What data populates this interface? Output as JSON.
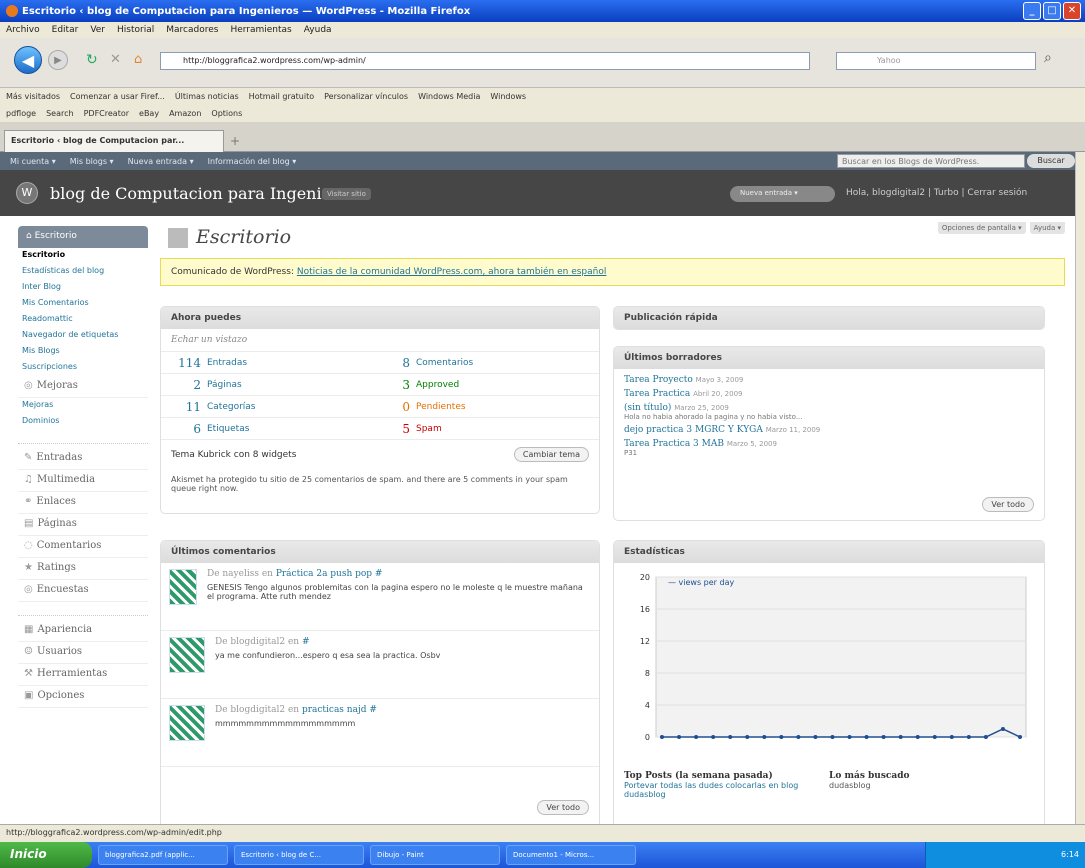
{
  "window": {
    "title": "Escritorio ‹ blog de Computacion para Ingenieros — WordPress - Mozilla Firefox"
  },
  "menu": [
    "Archivo",
    "Editar",
    "Ver",
    "Historial",
    "Marcadores",
    "Herramientas",
    "Ayuda"
  ],
  "nav": {
    "url": "http://bloggrafica2.wordpress.com/wp-admin/",
    "search_placeholder": "Yahoo"
  },
  "bookmarks": [
    "Más visitados",
    "Comenzar a usar Firef...",
    "Últimas noticias",
    "Hotmail gratuito",
    "Personalizar vínculos",
    "Windows Media",
    "Windows"
  ],
  "toolbar2": [
    "pdfloge",
    "Search",
    "PDFCreator",
    "eBay",
    "Amazon",
    "Options"
  ],
  "tab": {
    "label": "Escritorio ‹ blog de Computacion par..."
  },
  "adminbar": {
    "items": [
      "Mi cuenta ▾",
      "Mis blogs ▾",
      "Nueva entrada ▾",
      "Información del blog ▾"
    ],
    "search_placeholder": "Buscar en los Blogs de WordPress.",
    "search_button": "Buscar"
  },
  "wphead": {
    "site_title": "blog de Computacion para Ingenieros",
    "visit": "Visitar sitio",
    "new_post": "Nueva entrada ▾",
    "howdy": "Hola, blogdigital2 | Turbo | Cerrar sesión"
  },
  "screen_options": [
    "Opciones de pantalla ▾",
    "Ayuda ▾"
  ],
  "sidebar": {
    "head": "Escritorio",
    "submenu": [
      "Escritorio",
      "Estadísticas del blog",
      "Inter Blog",
      "Mis Comentarios",
      "Readomattic",
      "Navegador de etiquetas",
      "Mis Blogs",
      "Suscripciones"
    ],
    "mejoras": "Mejoras",
    "mejoras_sub": [
      "Mejoras",
      "Dominios"
    ],
    "items": [
      "Entradas",
      "Multimedia",
      "Enlaces",
      "Páginas",
      "Comentarios",
      "Ratings",
      "Encuestas"
    ],
    "items2": [
      "Apariencia",
      "Usuarios",
      "Herramientas",
      "Opciones"
    ]
  },
  "page": {
    "title": "Escritorio",
    "notice_prefix": "Comunicado de WordPress: ",
    "notice_link": "Noticias de la comunidad WordPress.com, ahora también en español"
  },
  "right_now": {
    "title": "Ahora puedes",
    "subtitle": "Echar un vistazo",
    "left": [
      {
        "n": "114",
        "l": "Entradas"
      },
      {
        "n": "2",
        "l": "Páginas"
      },
      {
        "n": "11",
        "l": "Categorías"
      },
      {
        "n": "6",
        "l": "Etiquetas"
      }
    ],
    "right": [
      {
        "n": "8",
        "l": "Comentarios",
        "c": "#21759b"
      },
      {
        "n": "3",
        "l": "Approved",
        "c": "#008000"
      },
      {
        "n": "0",
        "l": "Pendientes",
        "c": "#e66f00"
      },
      {
        "n": "5",
        "l": "Spam",
        "c": "#c00"
      }
    ],
    "theme": "Tema Kubrick con 8 widgets",
    "theme_button": "Cambiar tema",
    "akismet": "Akismet ha protegido tu sitio de 25 comentarios de spam. and there are 5 comments in your spam queue right now."
  },
  "quick_press": {
    "title": "Publicación rápida"
  },
  "drafts": {
    "title": "Últimos borradores",
    "items": [
      {
        "t": "Tarea Proyecto",
        "d": "Mayo 3, 2009",
        "ex": ""
      },
      {
        "t": "Tarea Practica",
        "d": "Abril 20, 2009",
        "ex": ""
      },
      {
        "t": "(sin título)",
        "d": "Marzo 25, 2009",
        "ex": "Hola no habia ahorado la pagina y no habia visto..."
      },
      {
        "t": "dejo practica 3 MGRC Y KYGA",
        "d": "Marzo 11, 2009",
        "ex": ""
      },
      {
        "t": "Tarea Practica 3 MAB",
        "d": "Marzo 5, 2009",
        "ex": "P31"
      }
    ],
    "button": "Ver todo"
  },
  "comments": {
    "title": "Últimos comentarios",
    "items": [
      {
        "author": "De nayeliss en ",
        "post": "Práctica 2a push pop #",
        "text": "GENESIS Tengo algunos problemitas con la pagina espero no le moleste q le muestre mañana el programa. Atte ruth mendez"
      },
      {
        "author": "De blogdigital2 en ",
        "post": "#",
        "text": "ya me confundieron...espero q esa sea la practica. Osbv"
      },
      {
        "author": "De blogdigital2 en ",
        "post": "practicas najd #",
        "text": "mmmmmmmmmmmmmmmmmm"
      }
    ],
    "button": "Ver todo"
  },
  "stats": {
    "title": "Estadísticas",
    "top_posts": "Top Posts (la semana pasada)",
    "top_posts_text": "Portevar todas las dudes colocarlas en blog dudasblog",
    "top_search": "Lo más buscado",
    "top_search_text": "dudasblog"
  },
  "chart_data": {
    "type": "line",
    "series": [
      {
        "name": "views per day",
        "values": [
          0,
          0,
          0,
          0,
          0,
          0,
          0,
          0,
          0,
          0,
          0,
          0,
          0,
          0,
          0,
          0,
          0,
          0,
          0,
          0,
          1,
          0
        ]
      }
    ],
    "ylim": [
      0,
      20
    ],
    "yticks": [
      "0",
      "4",
      "8",
      "12",
      "16",
      "20"
    ]
  },
  "statusbar": {
    "text": "http://bloggrafica2.wordpress.com/wp-admin/edit.php"
  },
  "taskbar": {
    "start": "Inicio",
    "tasks": [
      "bloggrafica2.pdf (applic...",
      "Escritorio ‹ blog de C...",
      "Dibujo - Paint",
      "Documento1 - Micros..."
    ],
    "clock": "6:14"
  }
}
